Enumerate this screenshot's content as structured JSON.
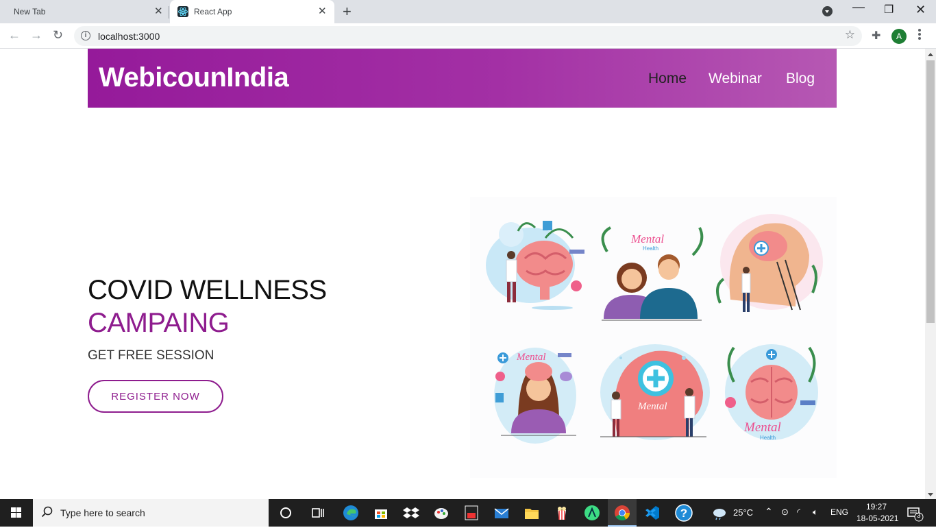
{
  "browser": {
    "tabs": [
      {
        "label": "New Tab",
        "active": false
      },
      {
        "label": "React App",
        "active": true
      }
    ],
    "url": "localhost:3000",
    "profile_initial": "A"
  },
  "site": {
    "brand": "WebicounIndia",
    "nav": [
      {
        "label": "Home",
        "active": true
      },
      {
        "label": "Webinar",
        "active": false
      },
      {
        "label": "Blog",
        "active": false
      }
    ],
    "hero": {
      "title_line1": "COVID WELLNESS",
      "title_line2": "CAMPAING",
      "subtitle": "GET FREE SESSION",
      "cta": "REGISTER NOW"
    },
    "illustration_labels": [
      "Mental",
      "Health"
    ],
    "colors": {
      "brand_purple": "#951a9a",
      "nav_gradient_end": "#b658b3",
      "accent": "#8e1c8e"
    }
  },
  "taskbar": {
    "search_placeholder": "Type here to search",
    "weather": "25°C",
    "language": "ENG",
    "time": "19:27",
    "date": "18-05-2021",
    "notification_count": "3"
  }
}
